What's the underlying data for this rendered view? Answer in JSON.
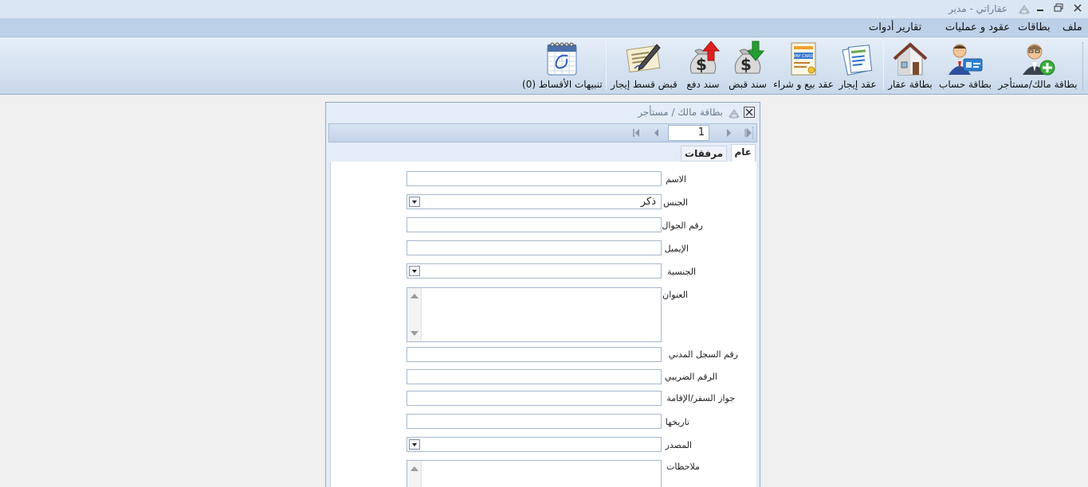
{
  "window": {
    "title": "عقاراتي - مدير",
    "icon": "building-icon"
  },
  "menu": [
    "ملف",
    "بطاقات",
    "عقود و عمليات",
    "تقارير",
    "أدوات"
  ],
  "toolbar": {
    "buttons": [
      {
        "label": "بطاقة مالك/مستأجر",
        "icon": "owner-tenant-add-icon"
      },
      {
        "label": "بطاقة حساب",
        "icon": "account-card-icon"
      },
      {
        "label": "بطاقة عقار",
        "icon": "house-icon"
      },
      {
        "label": "عقد إيجار",
        "icon": "lease-contract-icon"
      },
      {
        "label": "عقد بيع و شراء",
        "icon": "sale-contract-icon"
      },
      {
        "label": "سند قبض",
        "icon": "money-bag-receipt-icon"
      },
      {
        "label": "سند دفع",
        "icon": "money-bag-payment-icon"
      },
      {
        "label": "قبض قسط إيجار",
        "icon": "signed-document-icon"
      },
      {
        "label": "تنبيهات الأقساط (0)",
        "icon": "calendar-icon"
      }
    ]
  },
  "form": {
    "title": "بطاقة مالك / مستأجر",
    "navigator": {
      "record": "1"
    },
    "tabs": [
      "عام",
      "مرفقات"
    ],
    "active_tab": "عام",
    "fields": [
      {
        "label": "الاسم",
        "type": "text",
        "value": ""
      },
      {
        "label": "الجنس",
        "type": "combo",
        "value": "ذكر"
      },
      {
        "label": "رقم الجوال",
        "type": "text",
        "value": ""
      },
      {
        "label": "الإيميل",
        "type": "text",
        "value": ""
      },
      {
        "label": "الجنسية",
        "type": "combo",
        "value": ""
      },
      {
        "label": "العنوان",
        "type": "memo",
        "value": ""
      },
      {
        "label": "رقم السجل المدني",
        "type": "text",
        "value": ""
      },
      {
        "label": "الرقم الضريبي",
        "type": "text",
        "value": ""
      },
      {
        "label": "جواز السفر/الإقامة",
        "type": "text",
        "value": ""
      },
      {
        "label": "تاريخها",
        "type": "text",
        "value": ""
      },
      {
        "label": "المصدر",
        "type": "combo",
        "value": ""
      },
      {
        "label": "ملاحظات",
        "type": "memo",
        "value": ""
      }
    ]
  },
  "colors": {
    "menubar": "#bcd0e8",
    "toolbar": "#d4e1f0",
    "accent_red": "#e02020",
    "accent_green": "#22a030"
  }
}
